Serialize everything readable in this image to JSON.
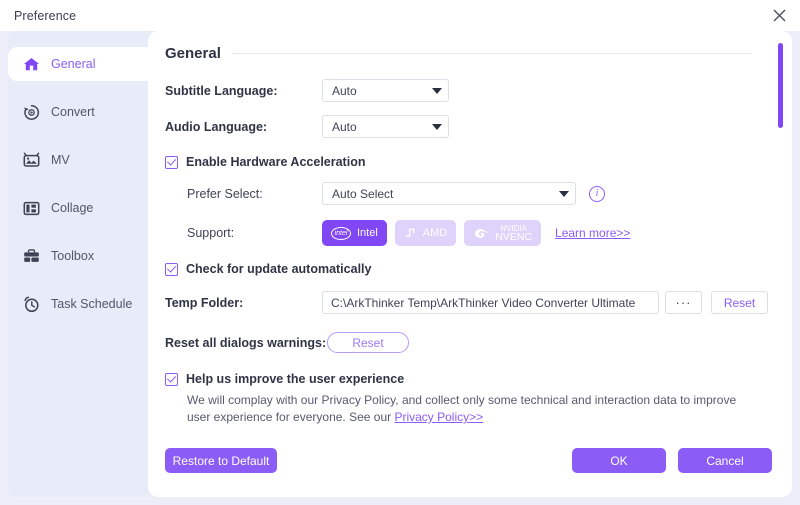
{
  "window": {
    "title": "Preference",
    "close_icon": "close-icon"
  },
  "sidebar": {
    "items": [
      {
        "label": "General",
        "icon": "home-icon",
        "active": true
      },
      {
        "label": "Convert",
        "icon": "convert-icon",
        "active": false
      },
      {
        "label": "MV",
        "icon": "mv-icon",
        "active": false
      },
      {
        "label": "Collage",
        "icon": "collage-icon",
        "active": false
      },
      {
        "label": "Toolbox",
        "icon": "toolbox-icon",
        "active": false
      },
      {
        "label": "Task Schedule",
        "icon": "task-schedule-icon",
        "active": false
      }
    ]
  },
  "main": {
    "section_title": "General",
    "subtitle_language": {
      "label": "Subtitle Language:",
      "value": "Auto"
    },
    "audio_language": {
      "label": "Audio Language:",
      "value": "Auto"
    },
    "hardware_acceleration": {
      "checkbox_label": "Enable Hardware Acceleration",
      "checked": true,
      "prefer_select": {
        "label": "Prefer Select:",
        "value": "Auto Select",
        "info_icon": "info-icon"
      },
      "support": {
        "label": "Support:",
        "badges": [
          {
            "name": "Intel",
            "text": "Intel",
            "active": true
          },
          {
            "name": "AMD",
            "text": "AMD",
            "active": false
          },
          {
            "name": "NVENC",
            "text": "NVIDIA NVENC",
            "line1": "NVIDIA",
            "line2": "NVENC",
            "active": false
          }
        ],
        "learn_more": "Learn more>>"
      }
    },
    "check_update": {
      "checkbox_label": "Check for update automatically",
      "checked": true
    },
    "temp_folder": {
      "label": "Temp Folder:",
      "value": "C:\\ArkThinker Temp\\ArkThinker Video Converter Ultimate",
      "browse_label": "···",
      "reset_label": "Reset"
    },
    "reset_dialogs": {
      "label": "Reset all dialogs warnings:",
      "reset_label": "Reset"
    },
    "improve_experience": {
      "checkbox_label": "Help us improve the user experience",
      "checked": true,
      "description_before": "We will complay with our Privacy Policy, and collect only some technical and interaction data to improve user experience for everyone. See our ",
      "link_text": "Privacy Policy>>"
    },
    "footer": {
      "restore_label": "Restore to Default",
      "ok_label": "OK",
      "cancel_label": "Cancel"
    }
  },
  "colors": {
    "accent": "#8b5cf6",
    "accent_strong": "#8247f5",
    "sidebar_bg": "#e8ecf8",
    "page_bg": "#eceff9"
  }
}
